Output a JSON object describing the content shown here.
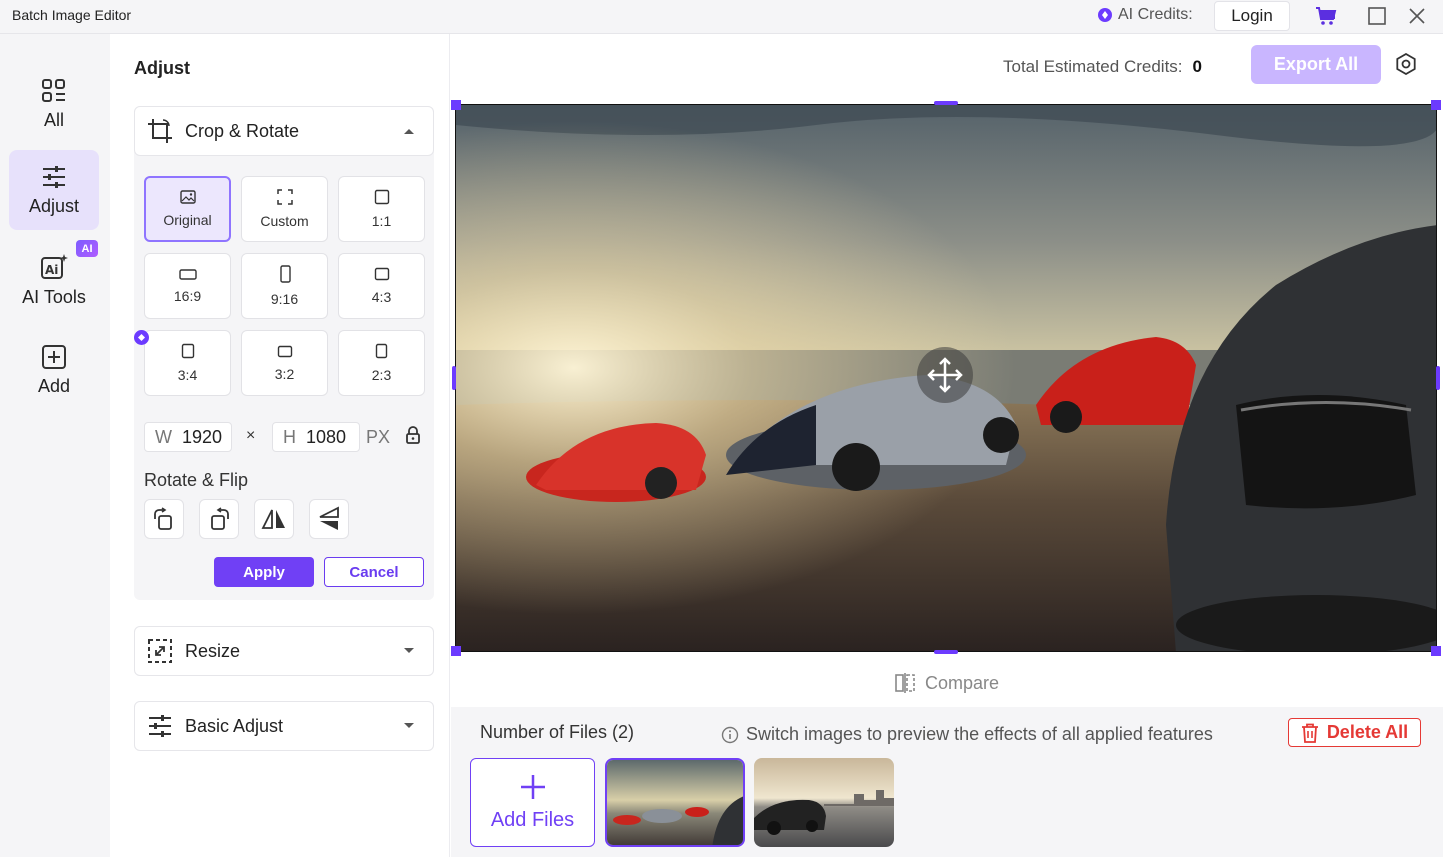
{
  "window": {
    "title": "Batch Image Editor",
    "ai_credits_label": "AI Credits:",
    "login_label": "Login",
    "cart_icon": "cart-icon",
    "maximize_icon": "maximize-icon",
    "close_icon": "close-icon"
  },
  "rail": {
    "items": [
      {
        "label": "All",
        "icon": "grid-icon"
      },
      {
        "label": "Adjust",
        "icon": "sliders-icon",
        "active": true
      },
      {
        "label": "AI Tools",
        "icon": "ai-tools-icon"
      },
      {
        "label": "Add",
        "icon": "plus-square-icon"
      }
    ],
    "ai_badge": "AI"
  },
  "panel": {
    "title": "Adjust",
    "crop": {
      "title": "Crop & Rotate",
      "ratios": [
        "Original",
        "Custom",
        "1:1",
        "16:9",
        "9:16",
        "4:3",
        "3:4",
        "3:2",
        "2:3"
      ],
      "selected": "Original",
      "width_label": "W",
      "width_value": "1920",
      "times": "×",
      "height_label": "H",
      "height_value": "1080",
      "unit": "PX",
      "rotate_flip_title": "Rotate & Flip",
      "apply_label": "Apply",
      "cancel_label": "Cancel"
    },
    "resize_title": "Resize",
    "basic_adjust_title": "Basic Adjust"
  },
  "main": {
    "total_credits_label": "Total Estimated Credits:",
    "total_credits_value": "0",
    "export_label": "Export All",
    "compare_label": "Compare",
    "files_count_label": "Number of Files (2)",
    "hint_label": "Switch images to preview the effects of all applied features",
    "delete_all_label": "Delete All",
    "add_files_label": "Add Files"
  },
  "colors": {
    "accent": "#7040f5",
    "accent_light": "#c9b6ff",
    "danger": "#e53935",
    "rail_bg": "#f5f5f7",
    "active_bg": "#e7e1fb"
  }
}
